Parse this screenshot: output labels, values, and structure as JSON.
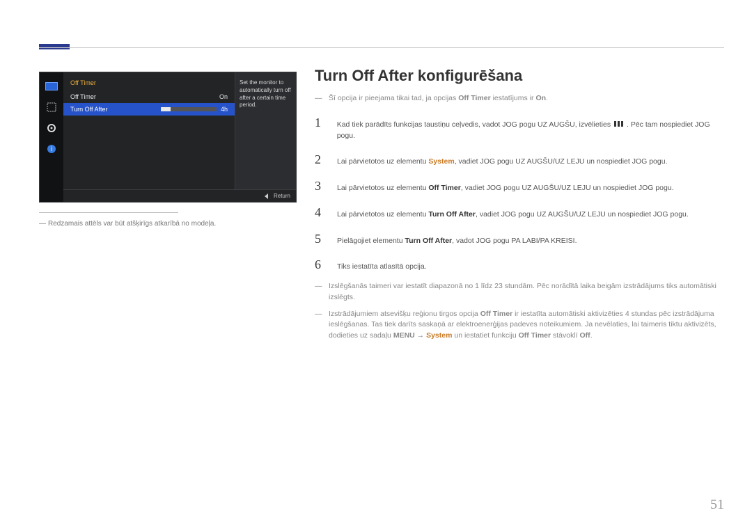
{
  "page_number": "51",
  "heading": "Turn Off After konfigurēšana",
  "precondition_parts": {
    "a": "Šī opcija ir pieejama tikai tad, ja opcijas ",
    "b": "Off Timer",
    "c": " iestatījums ir ",
    "d": "On",
    "e": "."
  },
  "steps": [
    {
      "n": "1",
      "pre": "Kad tiek parādīts funkcijas taustiņu ceļvedis, vadot JOG pogu UZ AUGŠU, izvēlieties ",
      "post": ". Pēc tam nospiediet JOG pogu."
    },
    {
      "n": "2",
      "pre": "Lai pārvietotos uz elementu ",
      "accent": "System",
      "post": ", vadiet JOG pogu UZ AUGŠU/UZ LEJU un nospiediet JOG pogu."
    },
    {
      "n": "3",
      "pre": "Lai pārvietotos uz elementu ",
      "bold": "Off Timer",
      "post": ", vadiet JOG pogu UZ AUGŠU/UZ LEJU un nospiediet JOG pogu."
    },
    {
      "n": "4",
      "pre": "Lai pārvietotos uz elementu ",
      "bold": "Turn Off After",
      "post": ", vadiet JOG pogu UZ AUGŠU/UZ LEJU un nospiediet JOG pogu."
    },
    {
      "n": "5",
      "pre": "Pielāgojiet elementu ",
      "bold": "Turn Off After",
      "post": ", vadot JOG pogu PA LABI/PA KREISI."
    },
    {
      "n": "6",
      "pre": "Tiks iestatīta atlasītā opcija."
    }
  ],
  "footnotes": {
    "f1": "Izslēgšanās taimeri var iestatīt diapazonā no 1 līdz 23 stundām. Pēc norādītā laika beigām izstrādājums tiks automātiski izslēgts.",
    "f2a": "Izstrādājumiem atsevišķu reģionu tirgos opcija ",
    "f2b": "Off Timer",
    "f2c": " ir iestatīta automātiski aktivizēties 4 stundas pēc izstrādājuma ieslēgšanas. Tas tiek darīts saskaņā ar elektroenerģijas padeves noteikumiem. Ja nevēlaties, lai taimeris tiktu aktivizēts, dodieties uz sadaļu ",
    "f2d": "MENU",
    "f2arrow": " → ",
    "f2e": "System",
    "f2f": " un iestatiet funkciju ",
    "f2g": "Off Timer",
    "f2h": " stāvoklī ",
    "f2i": "Off",
    "f2j": "."
  },
  "caption": "Redzamais attēls var būt atšķirīgs atkarībā no modeļa.",
  "osd": {
    "title": "Off Timer",
    "row1": {
      "label": "Off Timer",
      "value": "On"
    },
    "row2": {
      "label": "Turn Off After",
      "value": "4h"
    },
    "desc": "Set the monitor to automatically turn off after a certain time period.",
    "return": "Return"
  }
}
